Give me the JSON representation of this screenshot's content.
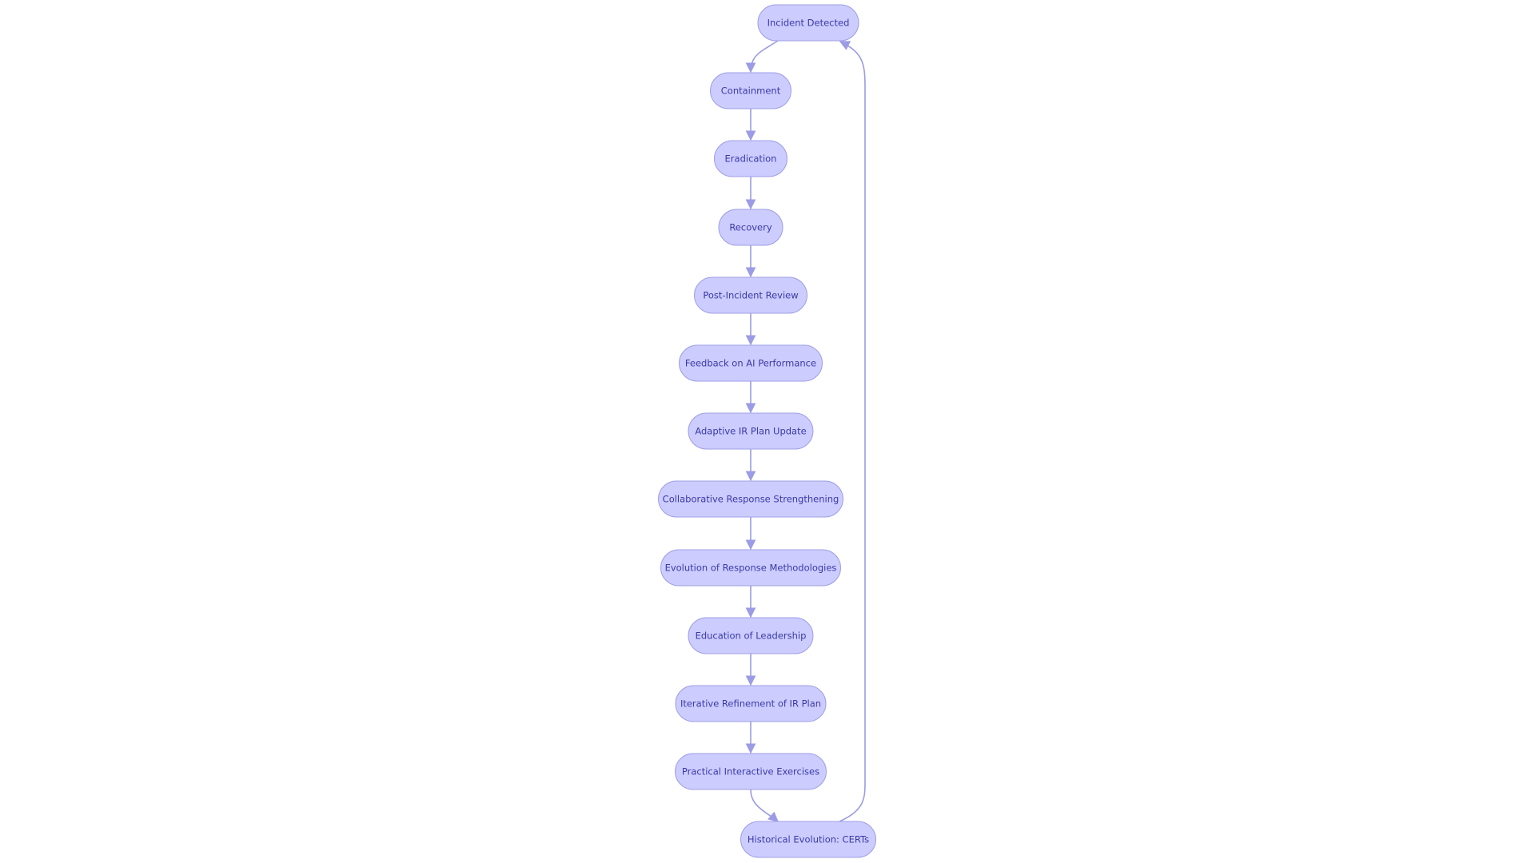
{
  "diagram": {
    "type": "flowchart",
    "direction": "top-down",
    "colors": {
      "node_fill": "#ccccff",
      "node_stroke": "#9f9fe6",
      "text": "#3a3aa8",
      "edge": "#9b9be6"
    },
    "nodes": [
      {
        "id": "A",
        "label": "Incident Detected"
      },
      {
        "id": "B",
        "label": "Containment"
      },
      {
        "id": "C",
        "label": "Eradication"
      },
      {
        "id": "D",
        "label": "Recovery"
      },
      {
        "id": "E",
        "label": "Post-Incident Review"
      },
      {
        "id": "F",
        "label": "Feedback on AI Performance"
      },
      {
        "id": "G",
        "label": "Adaptive IR Plan Update"
      },
      {
        "id": "H",
        "label": "Collaborative Response Strengthening"
      },
      {
        "id": "I",
        "label": "Evolution of Response Methodologies"
      },
      {
        "id": "J",
        "label": "Education of Leadership"
      },
      {
        "id": "K",
        "label": "Iterative Refinement of IR Plan"
      },
      {
        "id": "L",
        "label": "Practical Interactive Exercises"
      },
      {
        "id": "M",
        "label": "Historical Evolution: CERTs"
      }
    ],
    "edges": [
      [
        "A",
        "B"
      ],
      [
        "B",
        "C"
      ],
      [
        "C",
        "D"
      ],
      [
        "D",
        "E"
      ],
      [
        "E",
        "F"
      ],
      [
        "F",
        "G"
      ],
      [
        "G",
        "H"
      ],
      [
        "H",
        "I"
      ],
      [
        "I",
        "J"
      ],
      [
        "J",
        "K"
      ],
      [
        "K",
        "L"
      ],
      [
        "L",
        "M"
      ],
      [
        "M",
        "A"
      ]
    ]
  }
}
